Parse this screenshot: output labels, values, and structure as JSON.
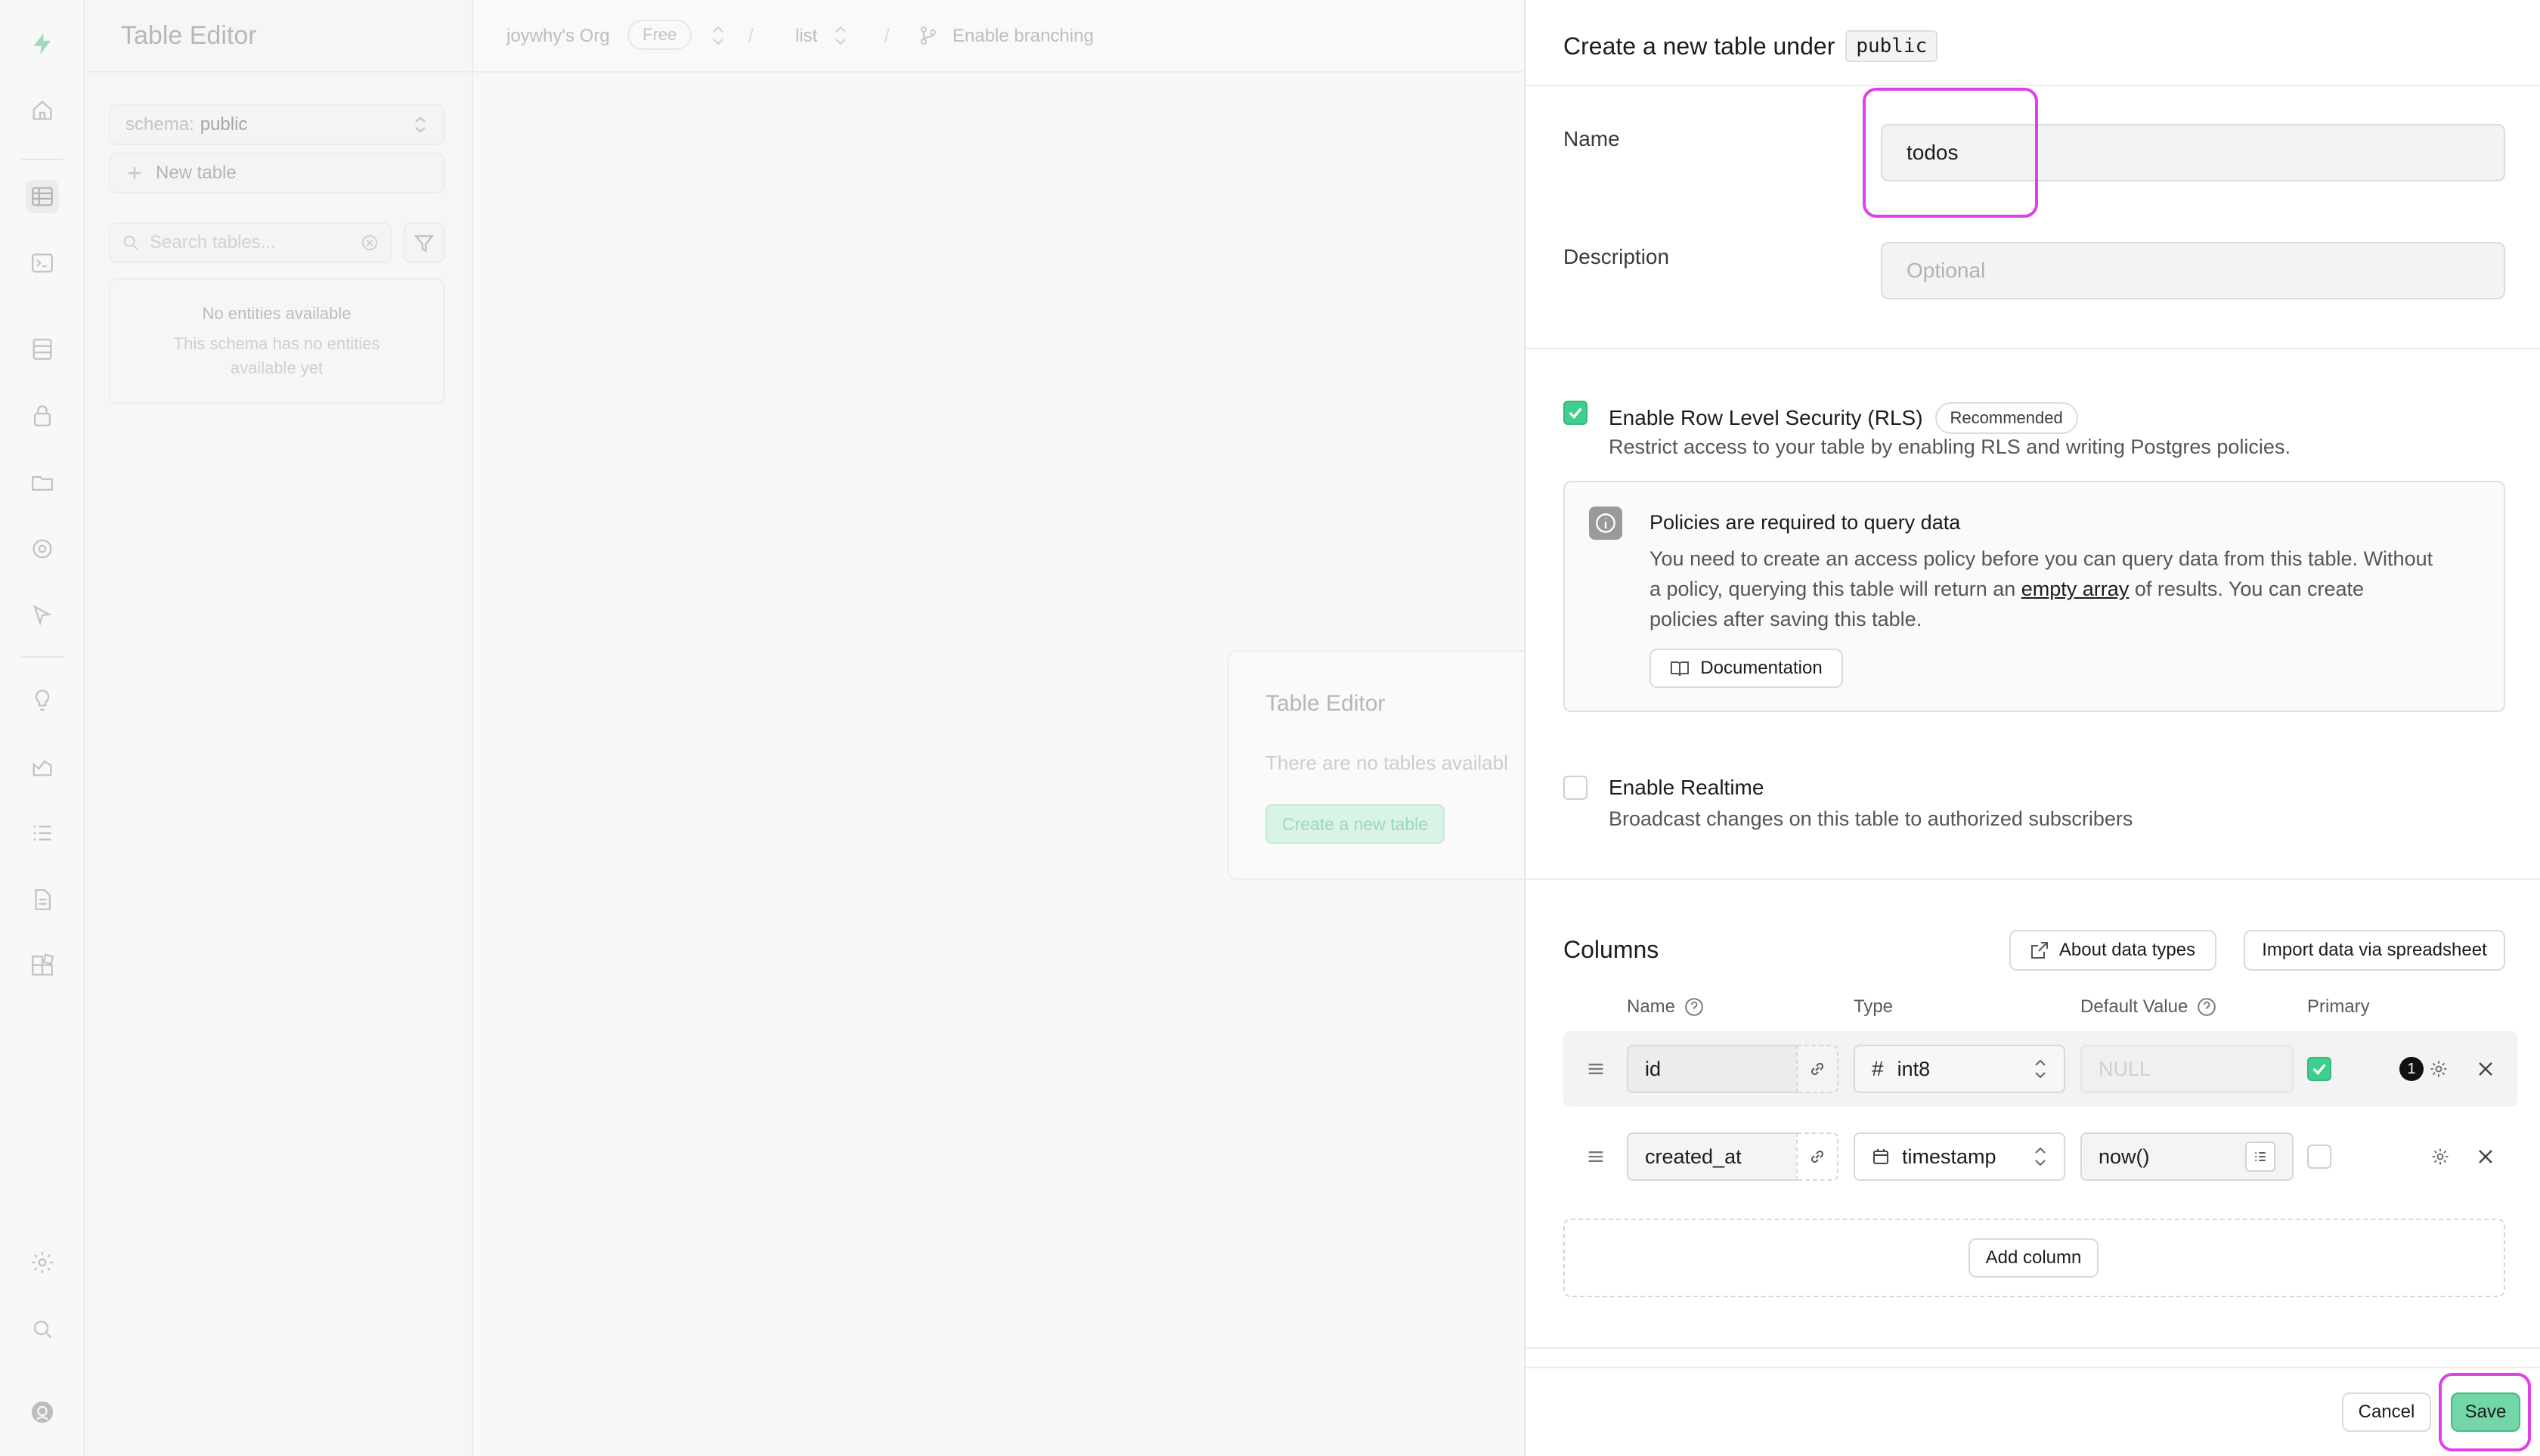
{
  "menu": {
    "title": "Table Editor",
    "schema_prefix": "schema:",
    "schema_value": "public",
    "new_table": "New table",
    "search_placeholder": "Search tables...",
    "empty_title": "No entities available",
    "empty_line1": "This schema has no entities",
    "empty_line2": "available yet"
  },
  "topbar": {
    "org": "joywhy's Org",
    "plan": "Free",
    "project": "list",
    "branching": "Enable branching"
  },
  "empty_card": {
    "title": "Table Editor",
    "text": "There are no tables availabl",
    "button": "Create a new table"
  },
  "drawer": {
    "header_text": "Create a new table under",
    "schema_badge": "public",
    "name_label": "Name",
    "name_value": "todos",
    "description_label": "Description",
    "description_placeholder": "Optional",
    "rls": {
      "label": "Enable Row Level Security (RLS)",
      "badge": "Recommended",
      "desc": "Restrict access to your table by enabling RLS and writing Postgres policies.",
      "checked": true
    },
    "policy": {
      "title": "Policies are required to query data",
      "line1": "You need to create an access policy before you can query data from this table. Without",
      "line2_pre": "a policy, querying this table will return an",
      "line2_link": "empty array",
      "line2_post": "of results. You can create",
      "line3": "policies after saving this table.",
      "doc_button": "Documentation"
    },
    "realtime": {
      "label": "Enable Realtime",
      "desc": "Broadcast changes on this table to authorized subscribers",
      "checked": false
    },
    "columns": {
      "title": "Columns",
      "about_button": "About data types",
      "import_button": "Import data via spreadsheet",
      "headers": {
        "name": "Name",
        "type": "Type",
        "default": "Default Value",
        "primary": "Primary"
      },
      "rows": [
        {
          "name": "id",
          "type": "int8",
          "default": "",
          "default_placeholder": "NULL",
          "primary": true,
          "badge": "1"
        },
        {
          "name": "created_at",
          "type": "timestamp",
          "default": "now()",
          "default_placeholder": "",
          "primary": false,
          "badge": ""
        }
      ],
      "add_button": "Add column"
    },
    "footer": {
      "cancel": "Cancel",
      "save": "Save"
    }
  },
  "colors": {
    "accent": "#3ecf8e",
    "highlight": "#e040e8"
  }
}
